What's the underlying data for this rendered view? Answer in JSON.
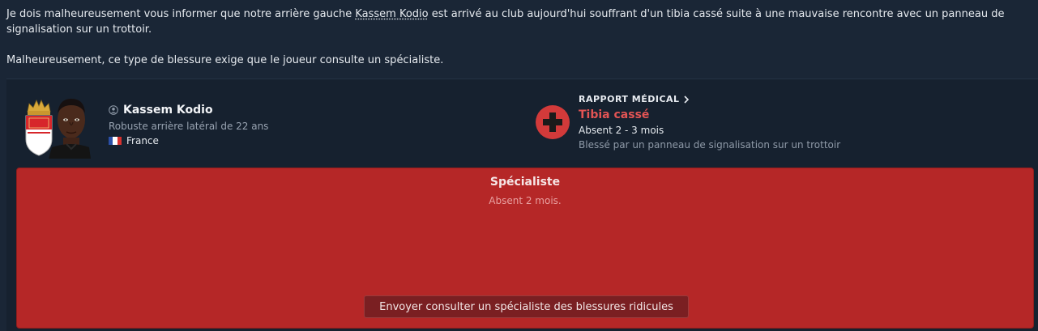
{
  "message": {
    "intro_before": "Je dois malheureusement vous informer que notre arrière gauche ",
    "player_link": "Kassem Kodio",
    "intro_after": " est arrivé au club aujourd'hui souffrant d'un tibia cassé suite à une mauvaise rencontre avec un panneau de signalisation sur un trottoir.",
    "paragraph2": "Malheureusement, ce type de blessure exige que le joueur consulte un spécialiste."
  },
  "player": {
    "name": "Kassem Kodio",
    "description": "Robuste arrière latéral de 22 ans",
    "nation": "France",
    "icon": "person-icon",
    "club_badge": "as-monaco-badge"
  },
  "medical": {
    "header": "RAPPORT MÉDICAL",
    "injury": "Tibia cassé",
    "absence": "Absent 2 - 3 mois",
    "cause": "Blessé par un panneau de signalisation sur un trottoir",
    "icon": "medical-cross-icon"
  },
  "specialist": {
    "title": "Spécialiste",
    "subtitle": "Absent 2 mois.",
    "button_label": "Envoyer consulter un spécialiste des blessures ridicules"
  },
  "colors": {
    "background": "#1a2636",
    "card": "#16212f",
    "panel_red": "#b52727",
    "injury_red": "#e35454",
    "button_dark_red": "#7a1f22",
    "france_blue": "#2b4fa6",
    "france_red": "#d8312f"
  }
}
